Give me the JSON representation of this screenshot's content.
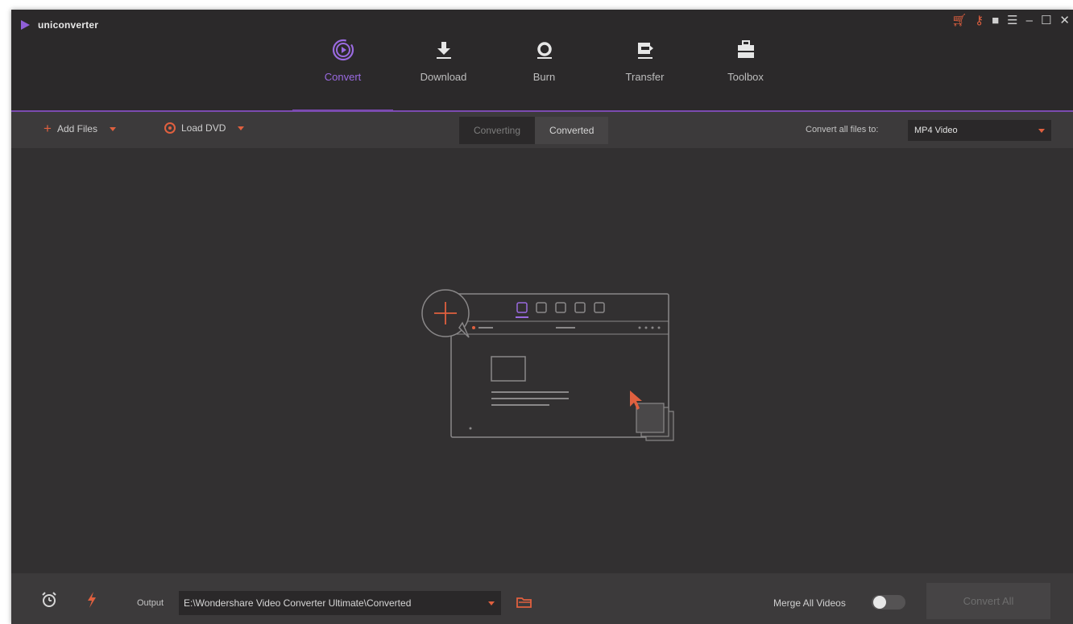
{
  "app": {
    "title": "uniconverter"
  },
  "nav": {
    "items": [
      {
        "label": "Convert",
        "icon": "convert-icon",
        "active": true
      },
      {
        "label": "Download",
        "icon": "download-icon",
        "active": false
      },
      {
        "label": "Burn",
        "icon": "burn-icon",
        "active": false
      },
      {
        "label": "Transfer",
        "icon": "transfer-icon",
        "active": false
      },
      {
        "label": "Toolbox",
        "icon": "toolbox-icon",
        "active": false
      }
    ]
  },
  "window_controls": [
    "cart-icon",
    "key-icon",
    "chat-icon",
    "menu-icon",
    "minimize-icon",
    "maximize-icon",
    "close-icon"
  ],
  "toolbar": {
    "add_files": "Add Files",
    "load_dvd": "Load DVD",
    "tab_converting": "Converting",
    "tab_converted": "Converted",
    "convert_all_label": "Convert all files to:",
    "format_value": "MP4 Video"
  },
  "bottom": {
    "output_label": "Output",
    "output_path": "E:\\Wondershare Video Converter Ultimate\\Converted",
    "merge_label": "Merge All Videos",
    "merge_enabled": false,
    "convert_all": "Convert All"
  },
  "colors": {
    "accent_purple": "#7b4bb0",
    "accent_orange": "#e0603f",
    "background": "#323031"
  }
}
